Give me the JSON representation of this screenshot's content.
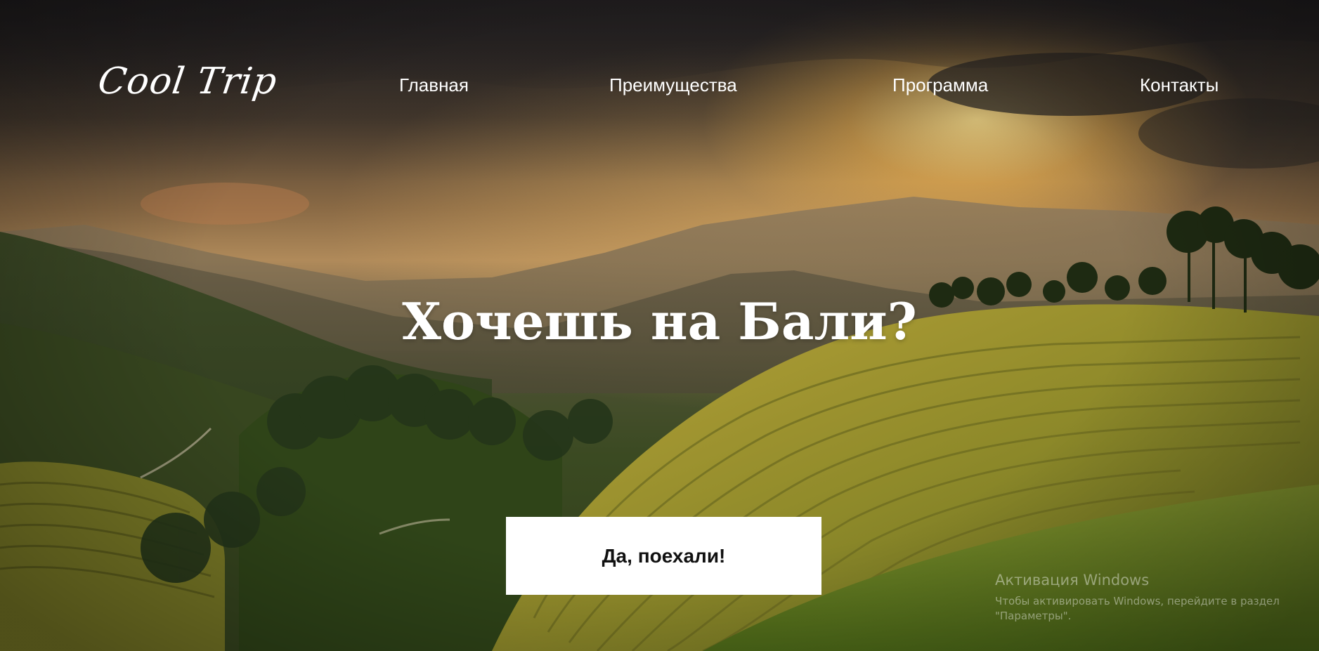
{
  "brand": {
    "logo_text": "Cool Trip"
  },
  "nav": {
    "items": [
      {
        "label": "Главная"
      },
      {
        "label": "Преимущества"
      },
      {
        "label": "Программа"
      },
      {
        "label": "Контакты"
      }
    ]
  },
  "hero": {
    "headline": "Хочешь на Бали?",
    "cta_label": "Да, поехали!"
  },
  "watermark": {
    "title": "Активация Windows",
    "line1": "Чтобы активировать Windows, перейдите в раздел",
    "line2": "\"Параметры\"."
  },
  "colors": {
    "text": "#ffffff",
    "button_bg": "#ffffff",
    "button_text": "#111111"
  }
}
